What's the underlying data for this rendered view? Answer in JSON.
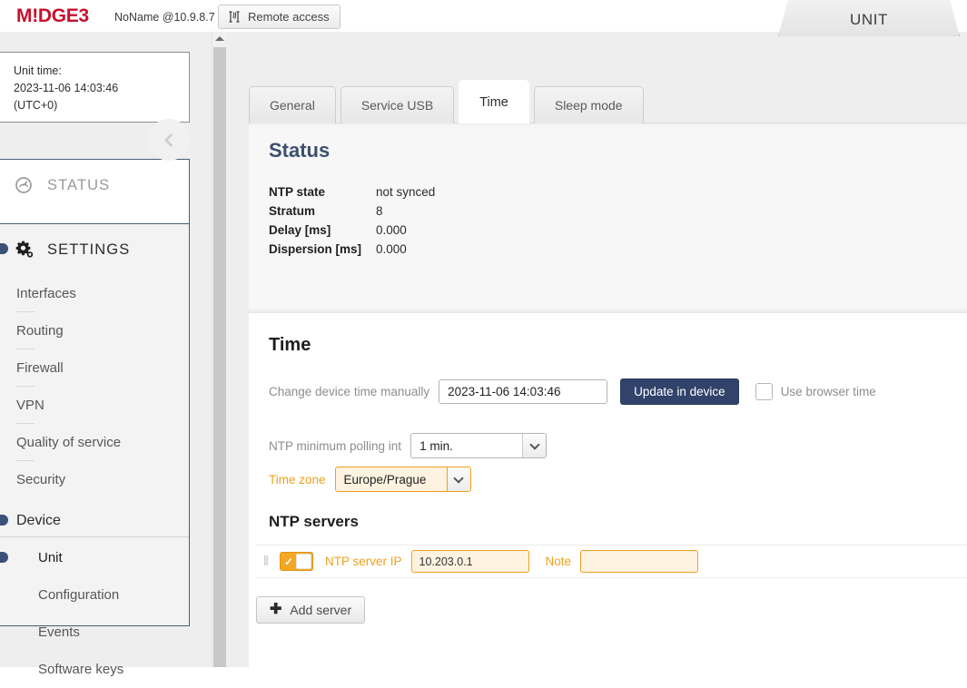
{
  "topbar": {
    "logo_m": "M",
    "logo_bang": "!",
    "logo_dge": "DGE",
    "logo_3": "3",
    "unit_name": "NoName @10.9.8.7",
    "remote_access_label": "Remote access",
    "remote_icon": "antenna-icon"
  },
  "unit_tab": {
    "label": "UNIT"
  },
  "sidebar": {
    "unit_time": {
      "line1": "Unit time:",
      "line2": "2023-11-06 14:03:46",
      "line3": "(UTC+0)"
    },
    "collapse_icon": "chevron-left-icon",
    "status": {
      "label": "STATUS",
      "icon": "gauge-icon"
    },
    "settings": {
      "label": "SETTINGS",
      "icon": "gear-icon"
    },
    "settings_items": [
      {
        "label": "Interfaces",
        "level": 1
      },
      {
        "label": "Routing",
        "level": 1
      },
      {
        "label": "Firewall",
        "level": 1
      },
      {
        "label": "VPN",
        "level": 1
      },
      {
        "label": "Quality of service",
        "level": 1
      },
      {
        "label": "Security",
        "level": 1
      }
    ],
    "device_group": {
      "label": "Device"
    },
    "device_items": [
      {
        "label": "Unit",
        "active": true
      },
      {
        "label": "Configuration",
        "active": false
      },
      {
        "label": "Events",
        "active": false
      },
      {
        "label": "Software keys",
        "active": false
      }
    ]
  },
  "tabs": [
    {
      "label": "General",
      "active": false
    },
    {
      "label": "Service USB",
      "active": false
    },
    {
      "label": "Time",
      "active": true
    },
    {
      "label": "Sleep mode",
      "active": false
    }
  ],
  "status_panel": {
    "title": "Status",
    "rows": [
      {
        "key": "NTP state",
        "value": "not synced"
      },
      {
        "key": "Stratum",
        "value": "8"
      },
      {
        "key": "Delay [ms]",
        "value": "0.000"
      },
      {
        "key": "Dispersion [ms]",
        "value": "0.000"
      }
    ]
  },
  "time_panel": {
    "title": "Time",
    "change_time_label": "Change device time manually",
    "change_time_value": "2023-11-06 14:03:46",
    "update_button": "Update in device",
    "use_browser_time_label": "Use browser time",
    "use_browser_time_checked": false,
    "polling_label": "NTP minimum polling int",
    "polling_value": "1 min.",
    "timezone_label": "Time zone",
    "timezone_value": "Europe/Prague"
  },
  "ntp_servers": {
    "title": "NTP servers",
    "drag_handle": "‖",
    "rows": [
      {
        "enabled": true,
        "ip_label": "NTP server IP",
        "ip_value": "10.203.0.1",
        "note_label": "Note",
        "note_value": ""
      }
    ],
    "add_button": "Add server",
    "add_icon": "plus-icon"
  },
  "colors": {
    "brand_red": "#c8102e",
    "accent_orange": "#f5a623",
    "primary_blue": "#31436b",
    "heading_blue": "#3c4f6d"
  }
}
